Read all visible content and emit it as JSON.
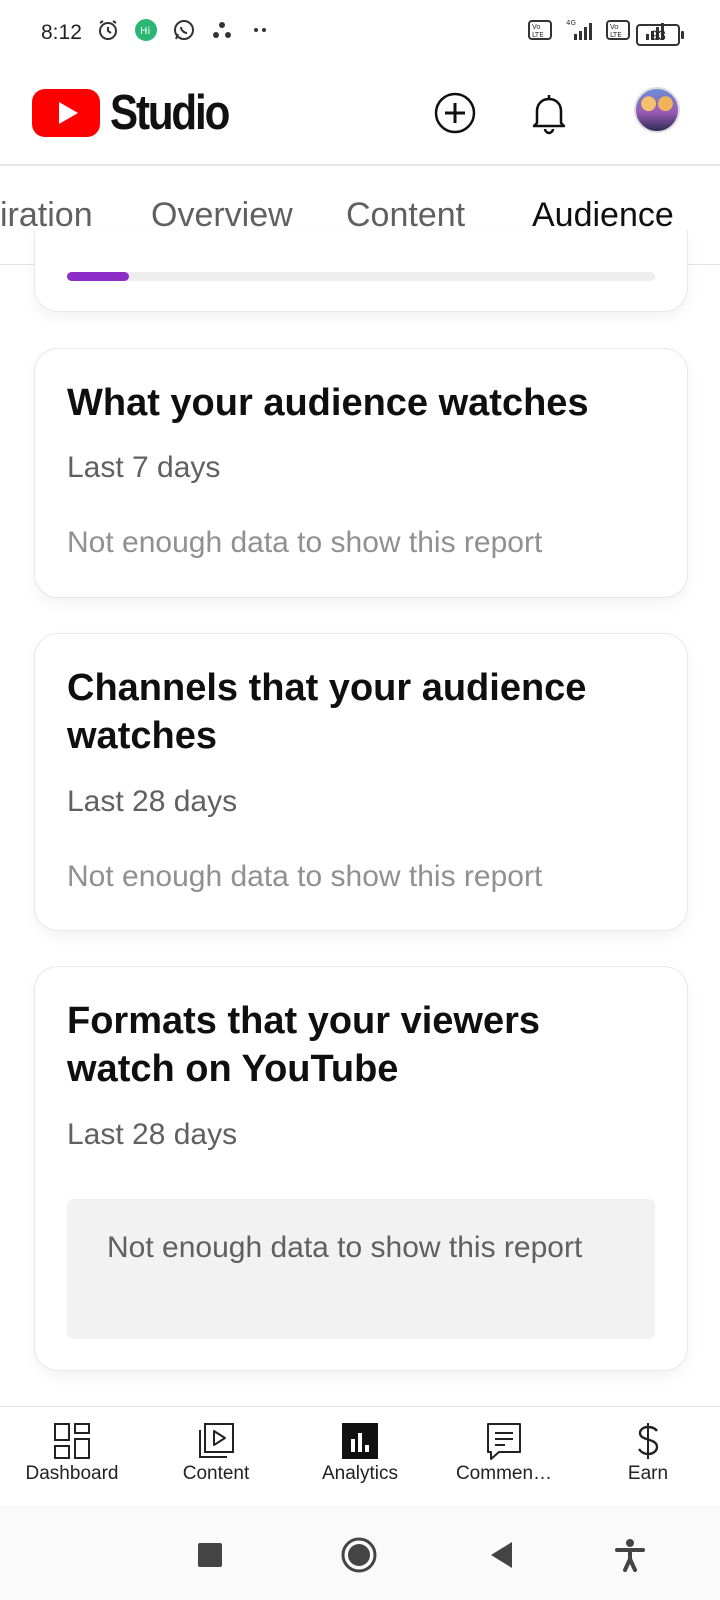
{
  "status_bar": {
    "time": "8:12",
    "battery": "93",
    "network": "4G"
  },
  "header": {
    "app_name": "Studio",
    "icons": [
      "create-icon",
      "bell-icon",
      "avatar"
    ]
  },
  "tabs": [
    {
      "label": "iration",
      "active": false
    },
    {
      "label": "Overview",
      "active": false
    },
    {
      "label": "Content",
      "active": false
    },
    {
      "label": "Audience",
      "active": true
    }
  ],
  "progress_card": {
    "progress_fraction": 0.105,
    "bar_color": "#8e2ec9"
  },
  "cards": [
    {
      "title": "What your audience watches",
      "period": "Last 7 days",
      "empty_text": "Not enough data to show this report"
    },
    {
      "title": "Channels that your audience watches",
      "period": "Last 28 days",
      "empty_text": "Not enough data to show this report"
    },
    {
      "title": "Formats that your viewers watch on YouTube",
      "period": "Last 28 days",
      "empty_text": "Not enough data to show this report"
    }
  ],
  "bottom_nav": [
    {
      "label": "Dashboard",
      "icon": "dashboard-icon",
      "active": false
    },
    {
      "label": "Content",
      "icon": "content-icon",
      "active": false
    },
    {
      "label": "Analytics",
      "icon": "analytics-icon",
      "active": true
    },
    {
      "label": "Commen…",
      "icon": "comments-icon",
      "active": false
    },
    {
      "label": "Earn",
      "icon": "dollar-icon",
      "active": false
    }
  ],
  "colors": {
    "brand_red": "#ff0000",
    "accent_purple": "#8e2ec9",
    "text_primary": "#0f0f0f",
    "text_secondary": "#606060"
  }
}
